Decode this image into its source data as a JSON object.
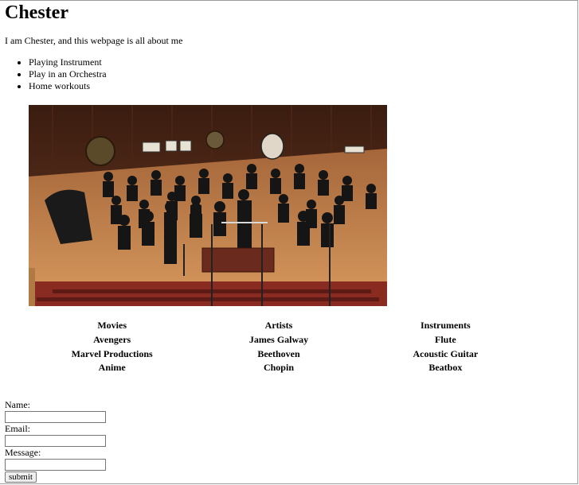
{
  "header": {
    "title": "Chester"
  },
  "intro": {
    "text": "I am Chester, and this webpage is all about me"
  },
  "hobbies": [
    "Playing Instrument",
    "Play in an Orchestra",
    "Home workouts"
  ],
  "table": {
    "headers": [
      "Movies",
      "Artists",
      "Instruments"
    ],
    "rows": [
      [
        "Avengers",
        "James Galway",
        "Flute"
      ],
      [
        "Marvel Productions",
        "Beethoven",
        "Acoustic Guitar"
      ],
      [
        "Anime",
        "Chopin",
        "Beatbox"
      ]
    ]
  },
  "form": {
    "name_label": "Name:",
    "email_label": "Email:",
    "message_label": "Message:",
    "name_value": "",
    "email_value": "",
    "message_value": "",
    "submit_label": "submit"
  },
  "colors": {
    "stage_wood": "#c98a4e",
    "back_wall": "#6b3a22",
    "seats": "#8a2b22"
  }
}
